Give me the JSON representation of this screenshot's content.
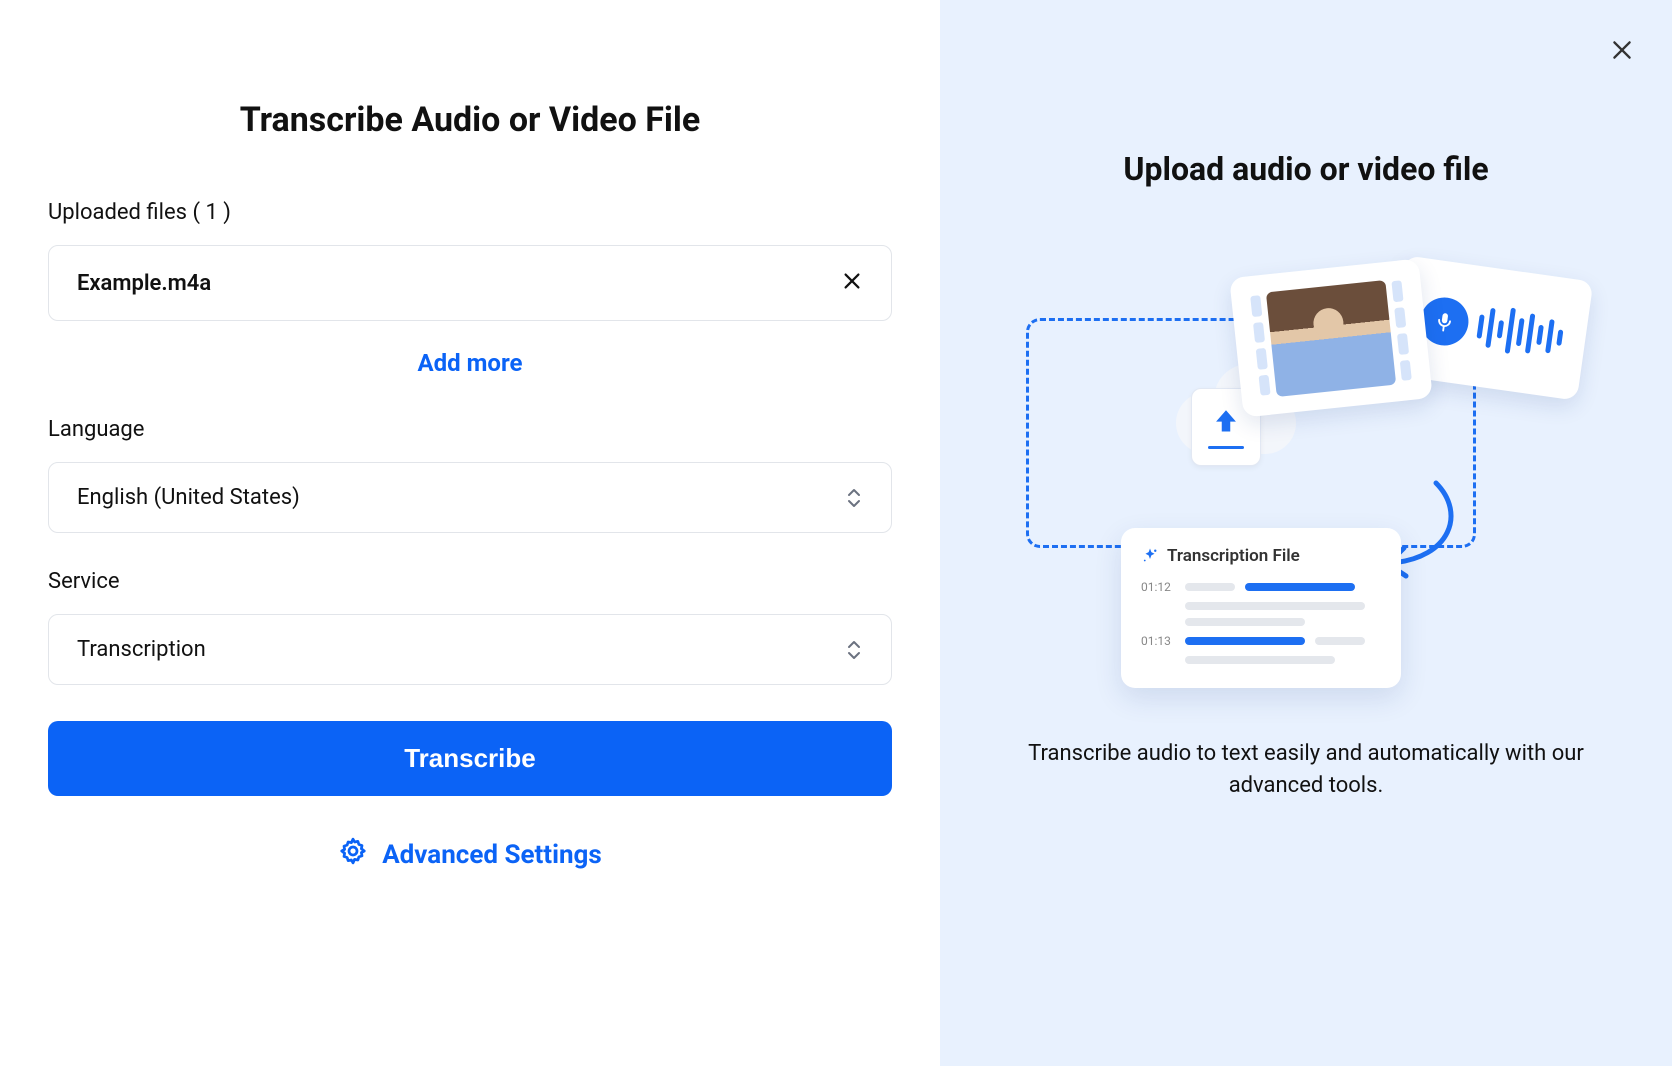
{
  "left": {
    "title": "Transcribe Audio or Video File",
    "uploaded_label_prefix": "Uploaded files",
    "uploaded_count_display": "( 1 )",
    "file_name": "Example.m4a",
    "add_more": "Add more",
    "language_label": "Language",
    "language_value": "English (United States)",
    "service_label": "Service",
    "service_value": "Transcription",
    "transcribe_btn": "Transcribe",
    "advanced_settings": "Advanced Settings"
  },
  "right": {
    "title": "Upload audio or video file",
    "transcription_card_title": "Transcription File",
    "timestamp1": "01:12",
    "timestamp2": "01:13",
    "caption": "Transcribe audio to text easily and automatically with our advanced tools."
  }
}
